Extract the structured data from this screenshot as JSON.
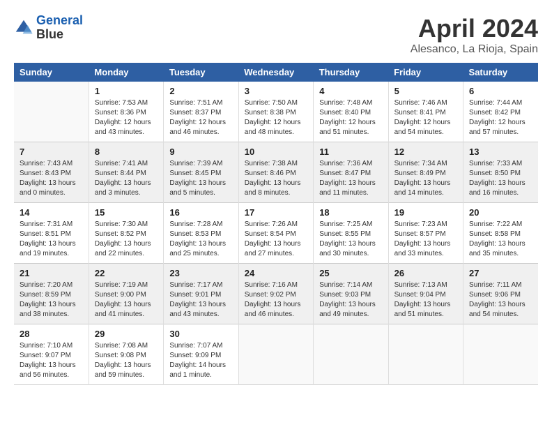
{
  "header": {
    "logo_line1": "General",
    "logo_line2": "Blue",
    "title": "April 2024",
    "subtitle": "Alesanco, La Rioja, Spain"
  },
  "columns": [
    "Sunday",
    "Monday",
    "Tuesday",
    "Wednesday",
    "Thursday",
    "Friday",
    "Saturday"
  ],
  "weeks": [
    [
      {
        "day": "",
        "info": ""
      },
      {
        "day": "1",
        "info": "Sunrise: 7:53 AM\nSunset: 8:36 PM\nDaylight: 12 hours\nand 43 minutes."
      },
      {
        "day": "2",
        "info": "Sunrise: 7:51 AM\nSunset: 8:37 PM\nDaylight: 12 hours\nand 46 minutes."
      },
      {
        "day": "3",
        "info": "Sunrise: 7:50 AM\nSunset: 8:38 PM\nDaylight: 12 hours\nand 48 minutes."
      },
      {
        "day": "4",
        "info": "Sunrise: 7:48 AM\nSunset: 8:40 PM\nDaylight: 12 hours\nand 51 minutes."
      },
      {
        "day": "5",
        "info": "Sunrise: 7:46 AM\nSunset: 8:41 PM\nDaylight: 12 hours\nand 54 minutes."
      },
      {
        "day": "6",
        "info": "Sunrise: 7:44 AM\nSunset: 8:42 PM\nDaylight: 12 hours\nand 57 minutes."
      }
    ],
    [
      {
        "day": "7",
        "info": "Sunrise: 7:43 AM\nSunset: 8:43 PM\nDaylight: 13 hours\nand 0 minutes."
      },
      {
        "day": "8",
        "info": "Sunrise: 7:41 AM\nSunset: 8:44 PM\nDaylight: 13 hours\nand 3 minutes."
      },
      {
        "day": "9",
        "info": "Sunrise: 7:39 AM\nSunset: 8:45 PM\nDaylight: 13 hours\nand 5 minutes."
      },
      {
        "day": "10",
        "info": "Sunrise: 7:38 AM\nSunset: 8:46 PM\nDaylight: 13 hours\nand 8 minutes."
      },
      {
        "day": "11",
        "info": "Sunrise: 7:36 AM\nSunset: 8:47 PM\nDaylight: 13 hours\nand 11 minutes."
      },
      {
        "day": "12",
        "info": "Sunrise: 7:34 AM\nSunset: 8:49 PM\nDaylight: 13 hours\nand 14 minutes."
      },
      {
        "day": "13",
        "info": "Sunrise: 7:33 AM\nSunset: 8:50 PM\nDaylight: 13 hours\nand 16 minutes."
      }
    ],
    [
      {
        "day": "14",
        "info": "Sunrise: 7:31 AM\nSunset: 8:51 PM\nDaylight: 13 hours\nand 19 minutes."
      },
      {
        "day": "15",
        "info": "Sunrise: 7:30 AM\nSunset: 8:52 PM\nDaylight: 13 hours\nand 22 minutes."
      },
      {
        "day": "16",
        "info": "Sunrise: 7:28 AM\nSunset: 8:53 PM\nDaylight: 13 hours\nand 25 minutes."
      },
      {
        "day": "17",
        "info": "Sunrise: 7:26 AM\nSunset: 8:54 PM\nDaylight: 13 hours\nand 27 minutes."
      },
      {
        "day": "18",
        "info": "Sunrise: 7:25 AM\nSunset: 8:55 PM\nDaylight: 13 hours\nand 30 minutes."
      },
      {
        "day": "19",
        "info": "Sunrise: 7:23 AM\nSunset: 8:57 PM\nDaylight: 13 hours\nand 33 minutes."
      },
      {
        "day": "20",
        "info": "Sunrise: 7:22 AM\nSunset: 8:58 PM\nDaylight: 13 hours\nand 35 minutes."
      }
    ],
    [
      {
        "day": "21",
        "info": "Sunrise: 7:20 AM\nSunset: 8:59 PM\nDaylight: 13 hours\nand 38 minutes."
      },
      {
        "day": "22",
        "info": "Sunrise: 7:19 AM\nSunset: 9:00 PM\nDaylight: 13 hours\nand 41 minutes."
      },
      {
        "day": "23",
        "info": "Sunrise: 7:17 AM\nSunset: 9:01 PM\nDaylight: 13 hours\nand 43 minutes."
      },
      {
        "day": "24",
        "info": "Sunrise: 7:16 AM\nSunset: 9:02 PM\nDaylight: 13 hours\nand 46 minutes."
      },
      {
        "day": "25",
        "info": "Sunrise: 7:14 AM\nSunset: 9:03 PM\nDaylight: 13 hours\nand 49 minutes."
      },
      {
        "day": "26",
        "info": "Sunrise: 7:13 AM\nSunset: 9:04 PM\nDaylight: 13 hours\nand 51 minutes."
      },
      {
        "day": "27",
        "info": "Sunrise: 7:11 AM\nSunset: 9:06 PM\nDaylight: 13 hours\nand 54 minutes."
      }
    ],
    [
      {
        "day": "28",
        "info": "Sunrise: 7:10 AM\nSunset: 9:07 PM\nDaylight: 13 hours\nand 56 minutes."
      },
      {
        "day": "29",
        "info": "Sunrise: 7:08 AM\nSunset: 9:08 PM\nDaylight: 13 hours\nand 59 minutes."
      },
      {
        "day": "30",
        "info": "Sunrise: 7:07 AM\nSunset: 9:09 PM\nDaylight: 14 hours\nand 1 minute."
      },
      {
        "day": "",
        "info": ""
      },
      {
        "day": "",
        "info": ""
      },
      {
        "day": "",
        "info": ""
      },
      {
        "day": "",
        "info": ""
      }
    ]
  ]
}
